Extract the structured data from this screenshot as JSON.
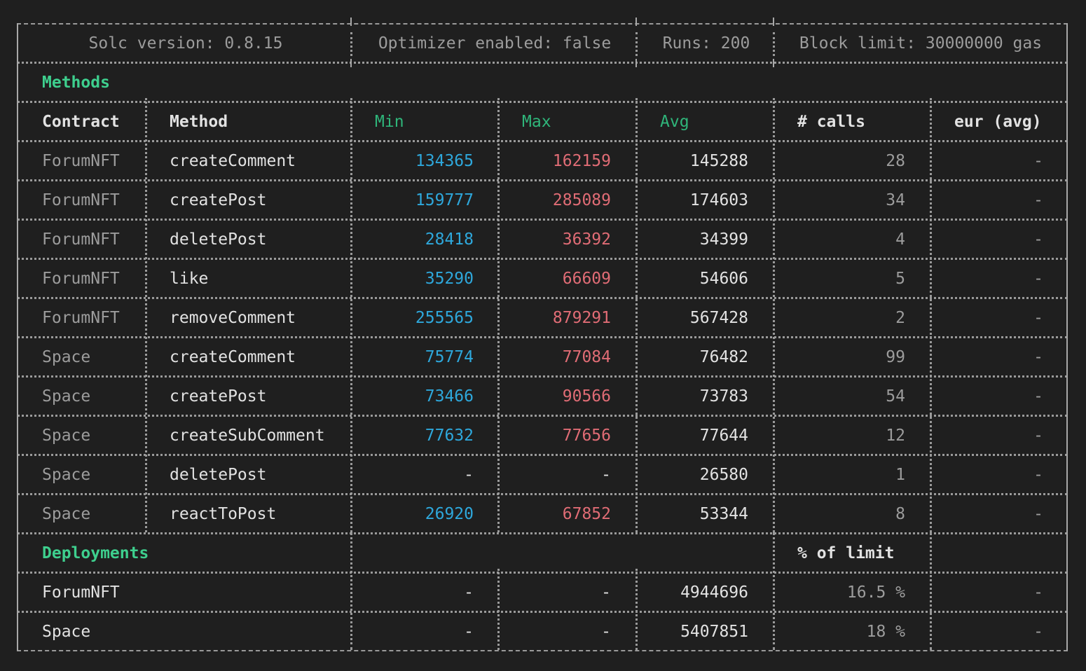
{
  "header": {
    "solc": "Solc version: 0.8.15",
    "optimizer": "Optimizer enabled: false",
    "runs": "Runs: 200",
    "block_limit": "Block limit: 30000000 gas"
  },
  "methods_label": "Methods",
  "columns": {
    "contract": "Contract",
    "method": "Method",
    "min": "Min",
    "max": "Max",
    "avg": "Avg",
    "calls": "# calls",
    "eur": "eur (avg)"
  },
  "method_rows": [
    {
      "contract": "ForumNFT",
      "method": "createComment",
      "min": "134365",
      "max": "162159",
      "avg": "145288",
      "calls": "28",
      "eur": "-"
    },
    {
      "contract": "ForumNFT",
      "method": "createPost",
      "min": "159777",
      "max": "285089",
      "avg": "174603",
      "calls": "34",
      "eur": "-"
    },
    {
      "contract": "ForumNFT",
      "method": "deletePost",
      "min": "28418",
      "max": "36392",
      "avg": "34399",
      "calls": "4",
      "eur": "-"
    },
    {
      "contract": "ForumNFT",
      "method": "like",
      "min": "35290",
      "max": "66609",
      "avg": "54606",
      "calls": "5",
      "eur": "-"
    },
    {
      "contract": "ForumNFT",
      "method": "removeComment",
      "min": "255565",
      "max": "879291",
      "avg": "567428",
      "calls": "2",
      "eur": "-"
    },
    {
      "contract": "Space",
      "method": "createComment",
      "min": "75774",
      "max": "77084",
      "avg": "76482",
      "calls": "99",
      "eur": "-"
    },
    {
      "contract": "Space",
      "method": "createPost",
      "min": "73466",
      "max": "90566",
      "avg": "73783",
      "calls": "54",
      "eur": "-"
    },
    {
      "contract": "Space",
      "method": "createSubComment",
      "min": "77632",
      "max": "77656",
      "avg": "77644",
      "calls": "12",
      "eur": "-"
    },
    {
      "contract": "Space",
      "method": "deletePost",
      "min": "-",
      "max": "-",
      "avg": "26580",
      "calls": "1",
      "eur": "-"
    },
    {
      "contract": "Space",
      "method": "reactToPost",
      "min": "26920",
      "max": "67852",
      "avg": "53344",
      "calls": "8",
      "eur": "-"
    }
  ],
  "deployments_label": "Deployments",
  "percent_label": "% of limit",
  "deployment_rows": [
    {
      "contract": "ForumNFT",
      "min": "-",
      "max": "-",
      "avg": "4944696",
      "percent": "16.5 %",
      "eur": "-"
    },
    {
      "contract": "Space",
      "min": "-",
      "max": "-",
      "avg": "5407851",
      "percent": "18 %",
      "eur": "-"
    }
  ],
  "colors": {
    "background": "#1f1f1f",
    "green": "#3ecf8e",
    "min_blue": "#2ea8dc",
    "max_red": "#e06c75",
    "text": "#e2e2e2",
    "dim": "#9c9c9c"
  }
}
